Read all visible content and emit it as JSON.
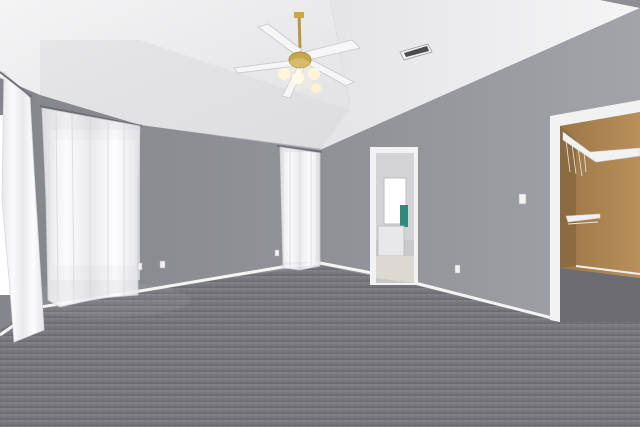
{
  "scene": {
    "kind": "photo",
    "colors": {
      "ceiling": "#ebebed",
      "wall_left": "#8d8e93",
      "wall_right": "#999aa0",
      "carpet": "#77767c",
      "baseboard": "#f4f4f4",
      "closet_interior": "#b58a55",
      "curtain": "#f3f3f6",
      "window_light": "#ffffff",
      "fan_brass": "#c9a64a"
    }
  }
}
